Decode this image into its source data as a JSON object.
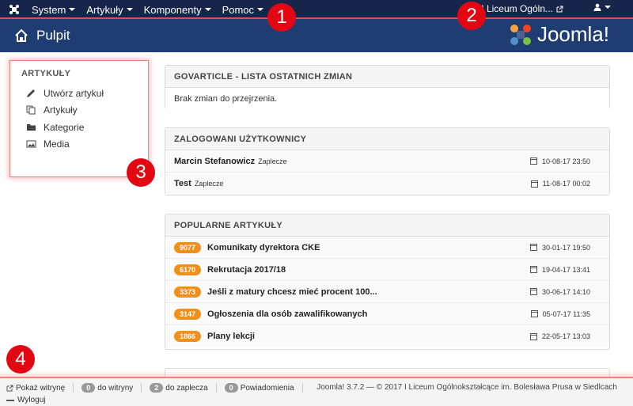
{
  "topbar": {
    "menu": [
      "System",
      "Artykuły",
      "Komponenty",
      "Pomoc"
    ],
    "site_name": "I Liceum Ogóln...",
    "user_icon": "user-icon"
  },
  "header": {
    "title": "Pulpit",
    "brand": "Joomla!"
  },
  "sidebar": {
    "heading": "ARTYKUŁY",
    "items": [
      {
        "label": "Utwórz artykuł",
        "icon": "pencil-icon"
      },
      {
        "label": "Artykuły",
        "icon": "copy-icon"
      },
      {
        "label": "Kategorie",
        "icon": "folder-icon"
      },
      {
        "label": "Media",
        "icon": "image-icon"
      }
    ]
  },
  "govarticle": {
    "title": "GOVARTICLE - LISTA OSTATNICH ZMIAN",
    "message": "Brak zmian do przejrzenia."
  },
  "logged_users": {
    "title": "ZALOGOWANI UŻYTKOWNICY",
    "rows": [
      {
        "name": "Marcin Stefanowicz",
        "area": "Zaplecze",
        "date": "10-08-17 23:50"
      },
      {
        "name": "Test",
        "area": "Zaplecze",
        "date": "11-08-17 00:02"
      }
    ]
  },
  "popular": {
    "title": "POPULARNE ARTYKUŁY",
    "rows": [
      {
        "hits": "9077",
        "title": "Komunikaty dyrektora CKE",
        "date": "30-01-17 19:50"
      },
      {
        "hits": "6170",
        "title": "Rekrutacja 2017/18",
        "date": "19-04-17 13:41"
      },
      {
        "hits": "3373",
        "title": "Jeśli z matury chcesz mieć procent 100...",
        "date": "30-06-17 14:10"
      },
      {
        "hits": "3147",
        "title": "Ogłoszenia dla osób zawalifikowanych",
        "date": "05-07-17 11:35"
      },
      {
        "hits": "1866",
        "title": "Plany lekcji",
        "date": "22-05-17 13:03"
      }
    ]
  },
  "footer": {
    "show_site": "Pokaż witrynę",
    "to_site_count": "0",
    "to_site_label": "do witryny",
    "to_admin_count": "2",
    "to_admin_label": "do zaplecza",
    "messages_count": "0",
    "messages_label": "Powiadomienia",
    "logout": "Wyloguj",
    "copyright": "Joomla! 3.7.2 — © 2017 I Liceum Ogólnokształcące im. Bolesława Prusa w Siedlcach"
  },
  "annotations": [
    "1",
    "2",
    "3",
    "4"
  ],
  "colors": {
    "annotation": "#e30613",
    "navbar": "#17254a",
    "header": "#1f3d73",
    "badge": "#f0901b"
  }
}
